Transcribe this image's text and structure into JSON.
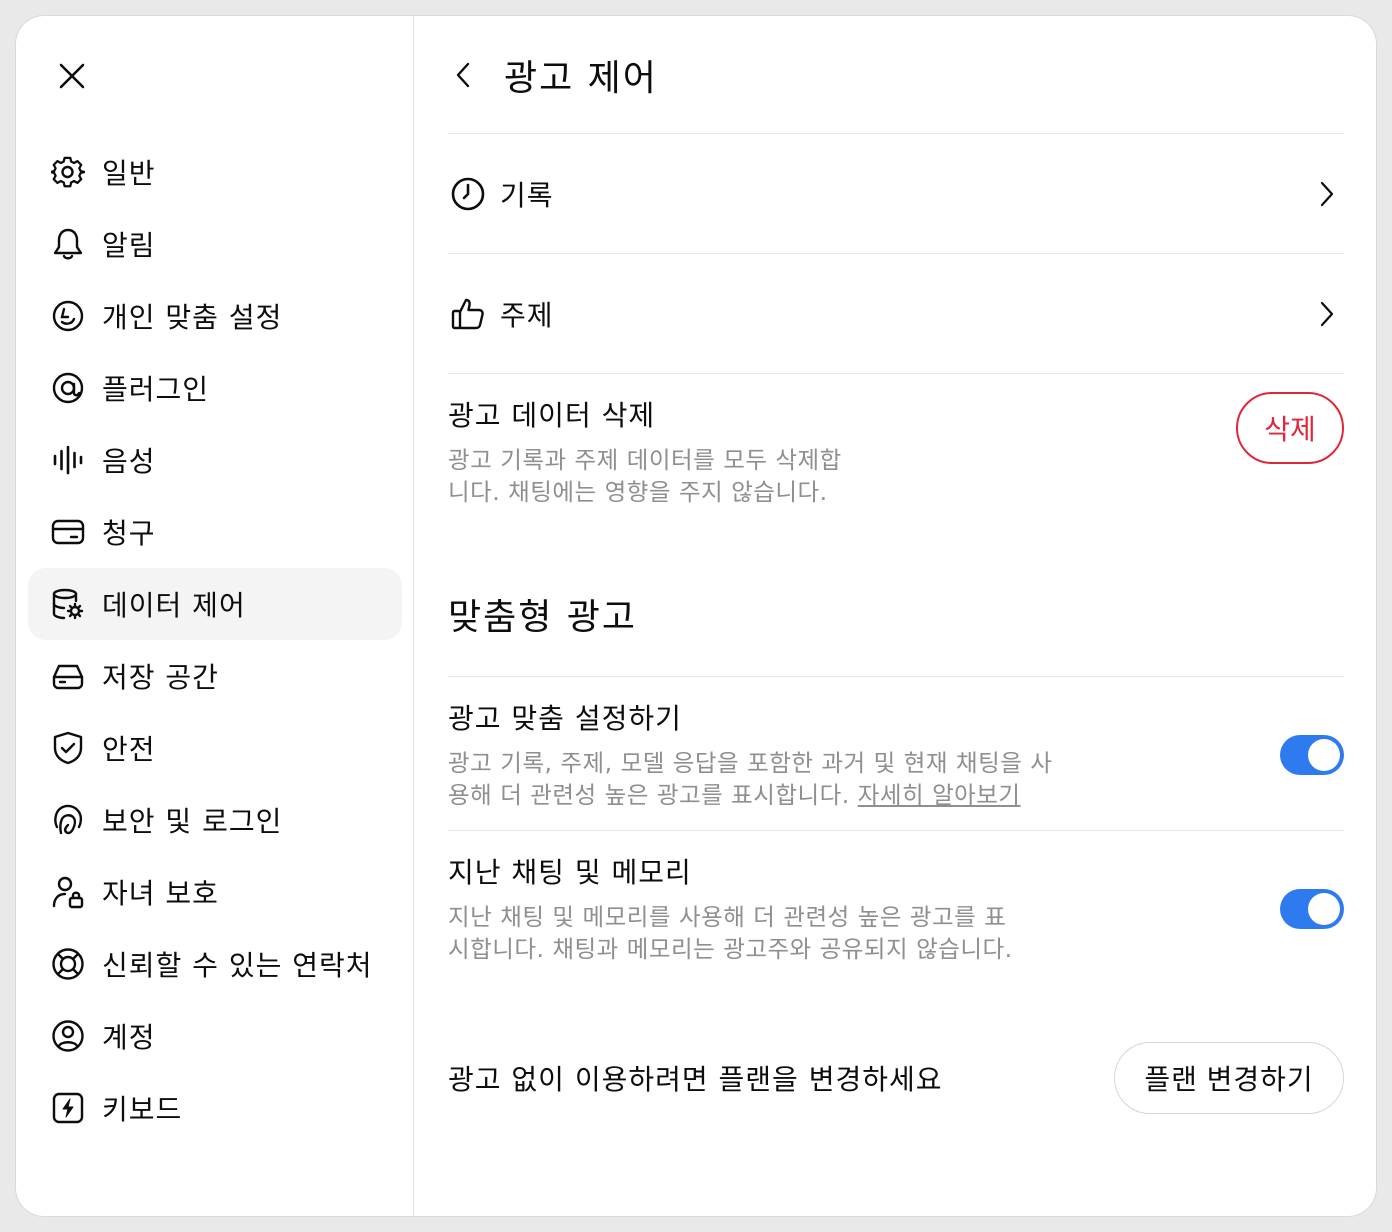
{
  "sidebar": {
    "close_icon": "close-icon",
    "items": [
      {
        "label": "일반",
        "icon": "gear-icon"
      },
      {
        "label": "알림",
        "icon": "bell-icon"
      },
      {
        "label": "개인 맞춤 설정",
        "icon": "personalization-icon"
      },
      {
        "label": "플러그인",
        "icon": "plugin-icon"
      },
      {
        "label": "음성",
        "icon": "voice-waveform-icon"
      },
      {
        "label": "청구",
        "icon": "credit-card-icon"
      },
      {
        "label": "데이터 제어",
        "icon": "database-gear-icon",
        "active": true
      },
      {
        "label": "저장 공간",
        "icon": "storage-drive-icon"
      },
      {
        "label": "안전",
        "icon": "shield-check-icon"
      },
      {
        "label": "보안 및 로그인",
        "icon": "security-login-icon"
      },
      {
        "label": "자녀 보호",
        "icon": "user-lock-icon"
      },
      {
        "label": "신뢰할 수 있는 연락처",
        "icon": "lifebuoy-icon"
      },
      {
        "label": "계정",
        "icon": "account-circle-icon"
      },
      {
        "label": "키보드",
        "icon": "keyboard-bolt-icon"
      }
    ]
  },
  "header": {
    "title": "광고 제어"
  },
  "rows": {
    "history": {
      "label": "기록"
    },
    "topics": {
      "label": "주제"
    }
  },
  "delete_ad_data": {
    "title": "광고 데이터 삭제",
    "description_line1": "광고 기록과 주제 데이터를 모두 삭제합",
    "description_line2": "니다. 채팅에는 영향을 주지 않습니다.",
    "button": "삭제"
  },
  "personalized_ads": {
    "section_title": "맞춤형 광고",
    "personalize": {
      "title": "광고 맞춤 설정하기",
      "description_line1": "광고 기록, 주제, 모델 응답을 포함한 과거 및 현재 채팅을 사",
      "description_line2": "용해 더 관련성 높은 광고를 표시합니다.",
      "link": "자세히 알아보기",
      "enabled": true
    },
    "past_chats_memory": {
      "title": "지난 채팅 및 메모리",
      "description_line1": "지난 채팅 및 메모리를 사용해 더 관련성 높은 광고를 표",
      "description_line2": "시합니다. 채팅과 메모리는 광고주와 공유되지 않습니다.",
      "enabled": true
    }
  },
  "plan": {
    "text": "광고 없이 이용하려면 플랜을 변경하세요",
    "button": "플랜 변경하기"
  },
  "colors": {
    "accent_toggle": "#2e7bf0",
    "danger": "#e0263a"
  }
}
